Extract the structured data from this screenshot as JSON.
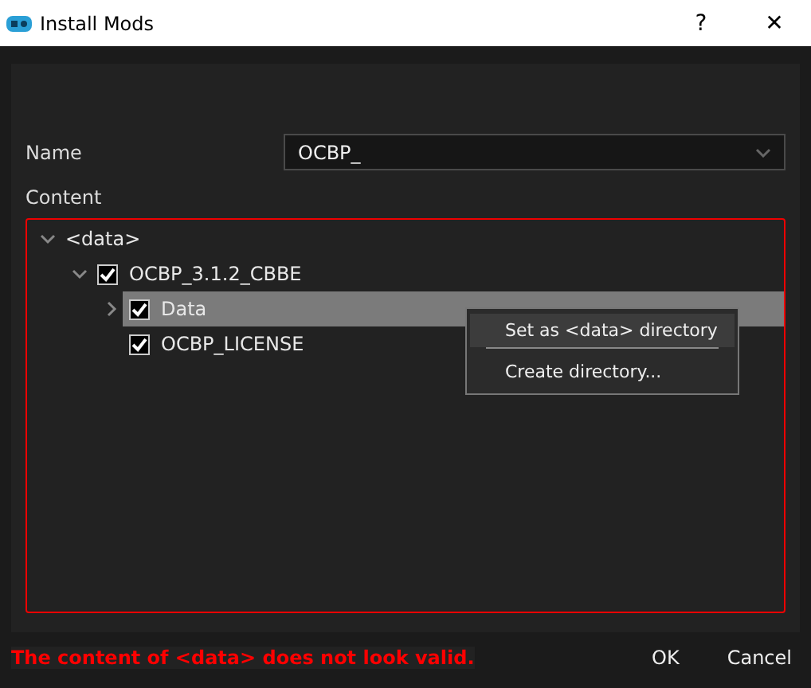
{
  "window": {
    "title": "Install Mods",
    "buttons": [
      "?",
      "✕"
    ]
  },
  "name_field": {
    "label": "Name",
    "value": "OCBP_"
  },
  "content": {
    "label": "Content",
    "invalid": true,
    "tree": [
      {
        "label": "<data>",
        "expanded": true,
        "selected": false,
        "children": [
          {
            "label": "OCBP_3.1.2_CBBE",
            "expanded": true,
            "checked": true,
            "selected": false,
            "children": [
              {
                "label": "Data",
                "expanded": false,
                "checked": true,
                "selected": true
              },
              {
                "label": "OCBP_LICENSE",
                "checked": true,
                "selected": false
              }
            ]
          }
        ]
      }
    ]
  },
  "context_menu": {
    "items": [
      {
        "label": "Set as <data> directory",
        "selected": true
      },
      {
        "label": "Create directory...",
        "selected": false
      }
    ]
  },
  "error_message": "The content of <data> does not look valid.",
  "buttons": [
    "OK",
    "Cancel"
  ]
}
